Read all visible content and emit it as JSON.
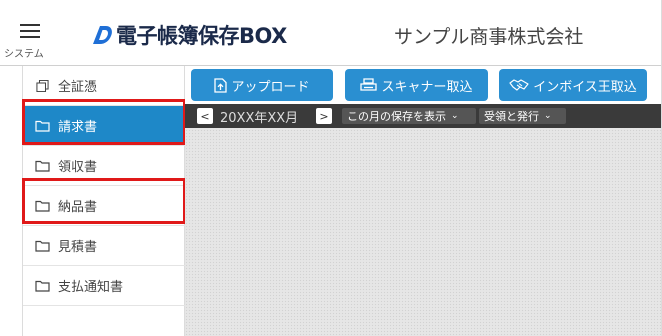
{
  "header": {
    "menu_label": "システム",
    "logo_text": "電子帳簿保存BOX",
    "company_name": "サンプル商事株式会社"
  },
  "sidebar": {
    "items": [
      {
        "label": "全証憑",
        "icon": "documents-icon",
        "active": false
      },
      {
        "label": "請求書",
        "icon": "folder-icon",
        "active": true
      },
      {
        "label": "領収書",
        "icon": "folder-icon",
        "active": false
      },
      {
        "label": "納品書",
        "icon": "folder-icon",
        "active": false
      },
      {
        "label": "見積書",
        "icon": "folder-icon",
        "active": false
      },
      {
        "label": "支払通知書",
        "icon": "folder-icon",
        "active": false
      }
    ]
  },
  "toolbar": {
    "upload_label": "アップロード",
    "scanner_label": "スキャナー取込",
    "invoice_label": "インボイス王取込"
  },
  "month_bar": {
    "prev": "<",
    "month": "20XX年XX月",
    "next": ">",
    "show_select": "この月の保存を表示",
    "type_select": "受領と発行"
  },
  "colors": {
    "accent": "#2a8fd1",
    "active_item": "#1e88c8",
    "highlight": "#e01919",
    "month_bar": "#3a3a3a"
  }
}
